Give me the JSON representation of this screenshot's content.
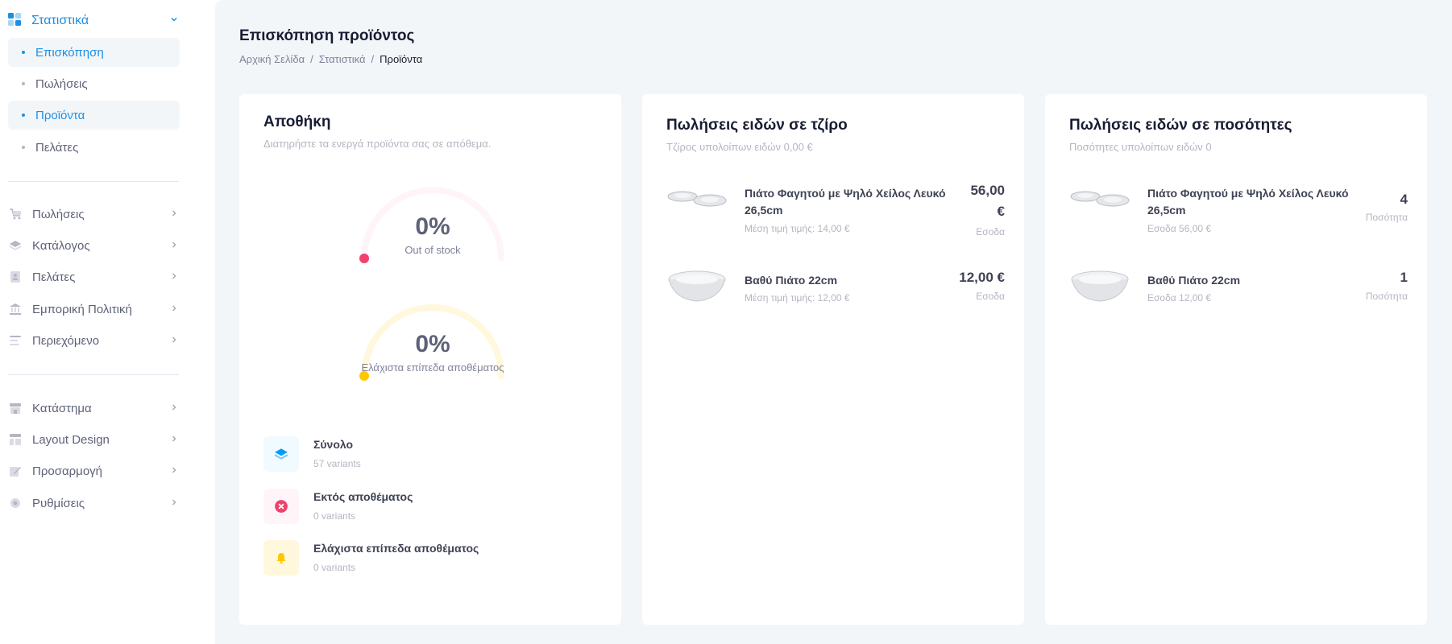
{
  "sidebar": {
    "section": {
      "label": "Στατιστικά",
      "icon": "dashboard-grid-icon"
    },
    "sub_items": [
      {
        "label": "Επισκόπηση",
        "active": true
      },
      {
        "label": "Πωλήσεις",
        "active": false
      },
      {
        "label": "Προϊόντα",
        "active": true
      },
      {
        "label": "Πελάτες",
        "active": false
      }
    ],
    "nav_group_1": [
      {
        "label": "Πωλήσεις",
        "icon": "cart-icon"
      },
      {
        "label": "Κατάλογος",
        "icon": "layers-icon"
      },
      {
        "label": "Πελάτες",
        "icon": "address-book-icon"
      },
      {
        "label": "Εμπορική Πολιτική",
        "icon": "bank-icon"
      },
      {
        "label": "Περιεχόμενο",
        "icon": "text-align-icon"
      }
    ],
    "nav_group_2": [
      {
        "label": "Κατάστημα",
        "icon": "shop-icon"
      },
      {
        "label": "Layout Design",
        "icon": "layout-icon"
      },
      {
        "label": "Προσαρμογή",
        "icon": "pencil-icon"
      },
      {
        "label": "Ρυθμίσεις",
        "icon": "gear-icon"
      }
    ]
  },
  "header": {
    "title": "Επισκόπηση προϊόντος",
    "breadcrumb": [
      "Αρχική Σελίδα",
      "Στατιστικά",
      "Προϊόντα"
    ]
  },
  "stock_card": {
    "title": "Αποθήκη",
    "subtitle": "Διατηρήστε τα ενεργά προϊόντα σας σε απόθεμα.",
    "gauges": [
      {
        "value": "0%",
        "caption": "Out of stock",
        "fraction": 0,
        "color": "#f1416c",
        "track": "#fff5f8"
      },
      {
        "value": "0%",
        "caption": "Ελάχιστα επίπεδα αποθέματος",
        "fraction": 0,
        "color": "#ffc700",
        "track": "#fff8dd"
      }
    ],
    "stats": [
      {
        "name": "Σύνολο",
        "value": "57 variants",
        "icon": "layers-icon",
        "bg": "#f1faff",
        "color": "#009ef7"
      },
      {
        "name": "Εκτός αποθέματος",
        "value": "0 variants",
        "icon": "close-circle-icon",
        "bg": "#fff5f8",
        "color": "#f1416c"
      },
      {
        "name": "Ελάχιστα επίπεδα αποθέματος",
        "value": "0 variants",
        "icon": "bell-icon",
        "bg": "#fff8dd",
        "color": "#ffc700"
      }
    ]
  },
  "revenue_card": {
    "title": "Πωλήσεις ειδών σε τζίρο",
    "subtitle": "Τζίρος υπολοίπων ειδών 0,00 €",
    "items": [
      {
        "name": "Πιάτο Φαγητού με Ψηλό Χείλος Λευκό 26,5cm",
        "meta": "Μέση τιμή τιμής: 14,00 €",
        "value_line1": "56,00",
        "value_line2": "€",
        "value_label": "Εσοδα",
        "thumb": "flat-plates-icon"
      },
      {
        "name": "Βαθύ Πιάτο 22cm",
        "meta": "Μέση τιμή τιμής: 12,00 €",
        "value_line1": "12,00 €",
        "value_line2": "",
        "value_label": "Εσοδα",
        "thumb": "deep-bowl-icon"
      }
    ]
  },
  "quantity_card": {
    "title": "Πωλήσεις ειδών σε ποσότητες",
    "subtitle": "Ποσότητες υπολοίπων ειδών 0",
    "items": [
      {
        "name": "Πιάτο Φαγητού με Ψηλό Χείλος Λευκό 26,5cm",
        "meta": "Εσοδα 56,00 €",
        "value": "4",
        "value_label": "Ποσότητα",
        "thumb": "flat-plates-icon"
      },
      {
        "name": "Βαθύ Πιάτο 22cm",
        "meta": "Εσοδα 12,00 €",
        "value": "1",
        "value_label": "Ποσότητα",
        "thumb": "deep-bowl-icon"
      }
    ]
  },
  "colors": {
    "accent": "#1e8fe1",
    "danger": "#f1416c",
    "warning": "#ffc700",
    "primary": "#009ef7"
  }
}
